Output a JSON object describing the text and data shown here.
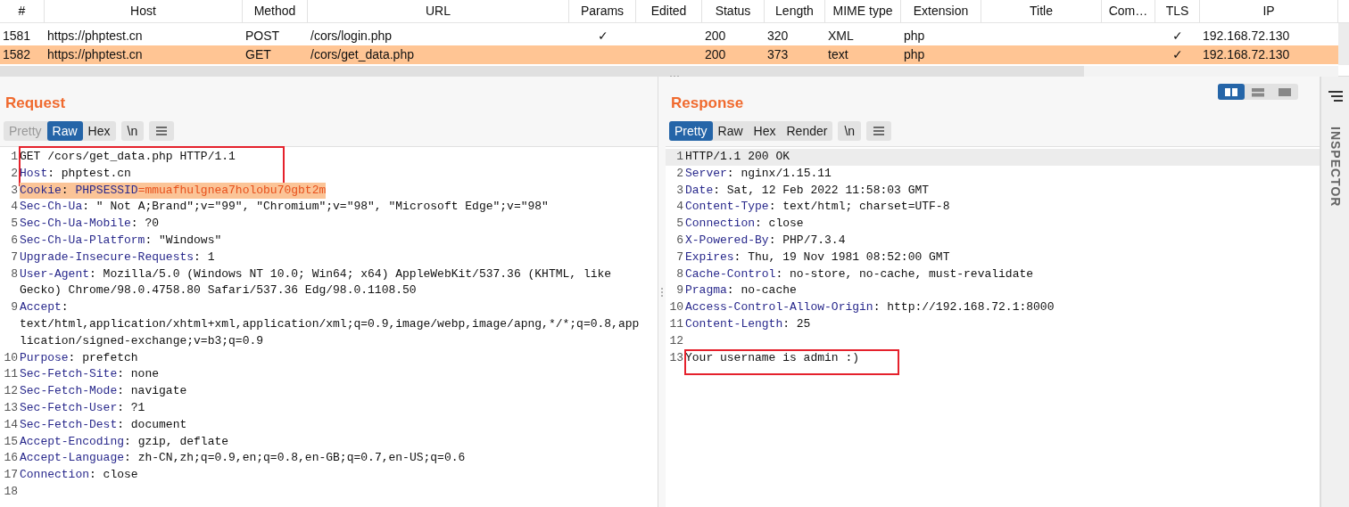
{
  "table": {
    "columns": [
      {
        "label": "#"
      },
      {
        "label": "Host"
      },
      {
        "label": "Method"
      },
      {
        "label": "URL"
      },
      {
        "label": "Params"
      },
      {
        "label": "Edited"
      },
      {
        "label": "Status"
      },
      {
        "label": "Length"
      },
      {
        "label": "MIME type"
      },
      {
        "label": "Extension"
      },
      {
        "label": "Title"
      },
      {
        "label": "Com…"
      },
      {
        "label": "TLS"
      },
      {
        "label": "IP"
      }
    ],
    "rows": [
      {
        "selected": false,
        "cells": [
          "1581",
          "https://phptest.cn",
          "POST",
          "/cors/login.php",
          "✓",
          null,
          "200",
          "320",
          "XML",
          "php",
          null,
          null,
          "✓",
          "192.168.72.130"
        ]
      },
      {
        "selected": true,
        "cells": [
          "1582",
          "https://phptest.cn",
          "GET",
          "/cors/get_data.php",
          null,
          null,
          "200",
          "373",
          "text",
          "php",
          null,
          null,
          "✓",
          "192.168.72.130"
        ]
      }
    ]
  },
  "request": {
    "title": "Request",
    "tabs": [
      {
        "label": "Pretty",
        "selected": false,
        "disabled": true
      },
      {
        "label": "Raw",
        "selected": true,
        "disabled": false
      },
      {
        "label": "Hex",
        "selected": false,
        "disabled": false
      }
    ],
    "buttons": [
      "\\n"
    ],
    "code": [
      {
        "boxed": true,
        "lines": [
          {
            "number": "1",
            "segments": [
              {
                "kind": "plain",
                "text": "GET /cors/get_data.php HTTP/1.1"
              }
            ]
          },
          {
            "number": "2",
            "segments": [
              {
                "kind": "name",
                "text": "Host"
              },
              {
                "kind": "plain",
                "text": ": phptest.cn"
              }
            ]
          }
        ]
      },
      {
        "boxed": false,
        "lines": [
          {
            "number": "3",
            "highlighted": true,
            "segments": [
              {
                "kind": "name",
                "text": "Cookie"
              },
              {
                "kind": "plain",
                "text": ": "
              },
              {
                "kind": "name",
                "text": "PHPSESSID"
              },
              {
                "kind": "value",
                "text": "=mmuafhulgnea7holobu70gbt2m"
              }
            ]
          },
          {
            "number": "4",
            "segments": [
              {
                "kind": "name",
                "text": "Sec-Ch-Ua"
              },
              {
                "kind": "plain",
                "text": ": \" Not A;Brand\";v=\"99\", \"Chromium\";v=\"98\", \"Microsoft Edge\";v=\"98\""
              }
            ]
          },
          {
            "number": "5",
            "segments": [
              {
                "kind": "name",
                "text": "Sec-Ch-Ua-Mobile"
              },
              {
                "kind": "plain",
                "text": ": ?0"
              }
            ]
          },
          {
            "number": "6",
            "segments": [
              {
                "kind": "name",
                "text": "Sec-Ch-Ua-Platform"
              },
              {
                "kind": "plain",
                "text": ": \"Windows\""
              }
            ]
          },
          {
            "number": "7",
            "segments": [
              {
                "kind": "name",
                "text": "Upgrade-Insecure-Requests"
              },
              {
                "kind": "plain",
                "text": ": 1"
              }
            ]
          },
          {
            "number": "8",
            "segments": [
              {
                "kind": "name",
                "text": "User-Agent"
              },
              {
                "kind": "plain",
                "text": ": Mozilla/5.0 (Windows NT 10.0; Win64; x64) AppleWebKit/537.36 (KHTML, like"
              }
            ],
            "wrap": [
              "Gecko) Chrome/98.0.4758.80 Safari/537.36 Edg/98.0.1108.50"
            ]
          },
          {
            "number": "9",
            "segments": [
              {
                "kind": "name",
                "text": "Accept"
              },
              {
                "kind": "plain",
                "text": ":"
              }
            ],
            "wrap": [
              "text/html,application/xhtml+xml,application/xml;q=0.9,image/webp,image/apng,*/*;q=0.8,app",
              "lication/signed-exchange;v=b3;q=0.9"
            ]
          },
          {
            "number": "10",
            "segments": [
              {
                "kind": "name",
                "text": "Purpose"
              },
              {
                "kind": "plain",
                "text": ": prefetch"
              }
            ]
          },
          {
            "number": "11",
            "segments": [
              {
                "kind": "name",
                "text": "Sec-Fetch-Site"
              },
              {
                "kind": "plain",
                "text": ": none"
              }
            ]
          },
          {
            "number": "12",
            "segments": [
              {
                "kind": "name",
                "text": "Sec-Fetch-Mode"
              },
              {
                "kind": "plain",
                "text": ": navigate"
              }
            ]
          },
          {
            "number": "13",
            "segments": [
              {
                "kind": "name",
                "text": "Sec-Fetch-User"
              },
              {
                "kind": "plain",
                "text": ": ?1"
              }
            ]
          },
          {
            "number": "14",
            "segments": [
              {
                "kind": "name",
                "text": "Sec-Fetch-Dest"
              },
              {
                "kind": "plain",
                "text": ": document"
              }
            ]
          },
          {
            "number": "15",
            "segments": [
              {
                "kind": "name",
                "text": "Accept-Encoding"
              },
              {
                "kind": "plain",
                "text": ": gzip, deflate"
              }
            ]
          },
          {
            "number": "16",
            "segments": [
              {
                "kind": "name",
                "text": "Accept-Language"
              },
              {
                "kind": "plain",
                "text": ": zh-CN,zh;q=0.9,en;q=0.8,en-GB;q=0.7,en-US;q=0.6"
              }
            ]
          },
          {
            "number": "17",
            "segments": [
              {
                "kind": "name",
                "text": "Connection"
              },
              {
                "kind": "plain",
                "text": ": close"
              }
            ]
          },
          {
            "number": "18"
          }
        ]
      }
    ]
  },
  "response": {
    "title": "Response",
    "tabs": [
      {
        "label": "Pretty",
        "selected": true,
        "disabled": false
      },
      {
        "label": "Raw",
        "selected": false,
        "disabled": false
      },
      {
        "label": "Hex",
        "selected": false,
        "disabled": false
      },
      {
        "label": "Render",
        "selected": false,
        "disabled": false
      }
    ],
    "buttons": [
      "\\n"
    ],
    "code": [
      {
        "boxed": false,
        "lines": [
          {
            "number": "1",
            "current": true,
            "segments": [
              {
                "kind": "plain",
                "text": "HTTP/1.1 200 OK"
              }
            ]
          },
          {
            "number": "2",
            "segments": [
              {
                "kind": "name",
                "text": "Server"
              },
              {
                "kind": "plain",
                "text": ": nginx/1.15.11"
              }
            ]
          },
          {
            "number": "3",
            "segments": [
              {
                "kind": "name",
                "text": "Date"
              },
              {
                "kind": "plain",
                "text": ": Sat, 12 Feb 2022 11:58:03 GMT"
              }
            ]
          },
          {
            "number": "4",
            "segments": [
              {
                "kind": "name",
                "text": "Content-Type"
              },
              {
                "kind": "plain",
                "text": ": text/html; charset=UTF-8"
              }
            ]
          },
          {
            "number": "5",
            "segments": [
              {
                "kind": "name",
                "text": "Connection"
              },
              {
                "kind": "plain",
                "text": ": close"
              }
            ]
          },
          {
            "number": "6",
            "segments": [
              {
                "kind": "name",
                "text": "X-Powered-By"
              },
              {
                "kind": "plain",
                "text": ": PHP/7.3.4"
              }
            ]
          },
          {
            "number": "7",
            "segments": [
              {
                "kind": "name",
                "text": "Expires"
              },
              {
                "kind": "plain",
                "text": ": Thu, 19 Nov 1981 08:52:00 GMT"
              }
            ]
          },
          {
            "number": "8",
            "segments": [
              {
                "kind": "name",
                "text": "Cache-Control"
              },
              {
                "kind": "plain",
                "text": ": no-store, no-cache, must-revalidate"
              }
            ]
          },
          {
            "number": "9",
            "segments": [
              {
                "kind": "name",
                "text": "Pragma"
              },
              {
                "kind": "plain",
                "text": ": no-cache"
              }
            ]
          },
          {
            "number": "10",
            "segments": [
              {
                "kind": "name",
                "text": "Access-Control-Allow-Origin"
              },
              {
                "kind": "plain",
                "text": ": http://192.168.72.1:8000"
              }
            ]
          },
          {
            "number": "11",
            "segments": [
              {
                "kind": "name",
                "text": "Content-Length"
              },
              {
                "kind": "plain",
                "text": ": 25"
              }
            ]
          },
          {
            "number": "12"
          }
        ]
      },
      {
        "boxed": true,
        "lines": [
          {
            "number": "13",
            "segments": [
              {
                "kind": "plain",
                "text": "Your username is admin :)"
              }
            ]
          }
        ]
      }
    ]
  },
  "view_modes": [
    {
      "selected": true
    },
    {
      "selected": false
    },
    {
      "selected": false
    }
  ],
  "inspector": {
    "label": "INSPECTOR"
  }
}
